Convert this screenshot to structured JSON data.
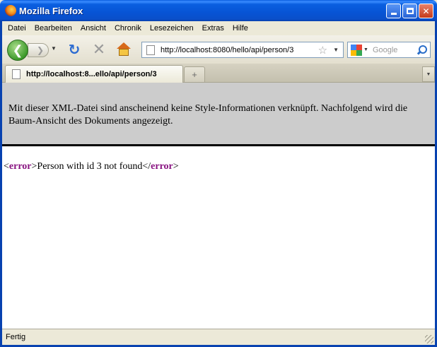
{
  "window": {
    "title": "Mozilla Firefox",
    "minimize_glyph": "",
    "close_glyph": "✕"
  },
  "menu": {
    "items": [
      {
        "label": "Datei"
      },
      {
        "label": "Bearbeiten"
      },
      {
        "label": "Ansicht"
      },
      {
        "label": "Chronik"
      },
      {
        "label": "Lesezeichen"
      },
      {
        "label": "Extras"
      },
      {
        "label": "Hilfe"
      }
    ]
  },
  "toolbar": {
    "back_glyph": "❮",
    "forward_glyph": "❯",
    "history_dropdown_glyph": "▼",
    "reload_glyph": "↻",
    "stop_glyph": "✕",
    "url": "http://localhost:8080/hello/api/person/3",
    "bookmark_glyph": "☆",
    "url_dropdown_glyph": "▼",
    "search_engine_dropdown_glyph": "▼",
    "search_placeholder": "Google"
  },
  "tabs": {
    "active_label": "http://localhost:8...ello/api/person/3",
    "new_tab_glyph": "+",
    "list_glyph": "▼"
  },
  "content": {
    "notice": "Mit dieser XML-Datei sind anscheinend keine Style-Informationen verknüpft. Nachfolgend wird die Baum-Ansicht des Dokuments angezeigt.",
    "xml_open_bracket": "<",
    "xml_tag_open": "error",
    "xml_close_bracket": ">",
    "xml_text": "Person with id 3 not found",
    "xml_end_open": "</",
    "xml_tag_close": "error",
    "xml_end_close": ">"
  },
  "status": {
    "text": "Fertig"
  }
}
